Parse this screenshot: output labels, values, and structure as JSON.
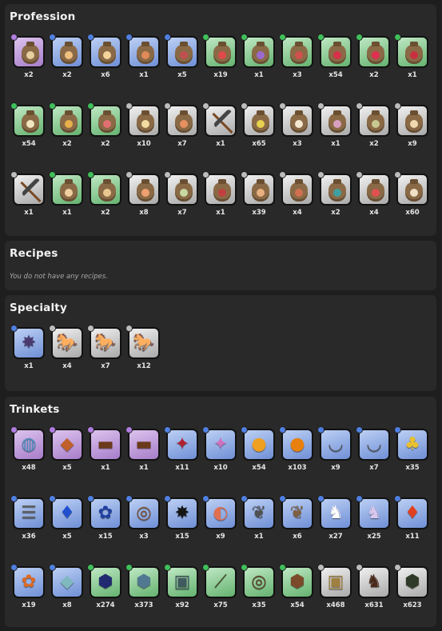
{
  "sections": {
    "profession": {
      "title": "Profession",
      "rows": [
        [
          {
            "icon": "seed-bag-icon",
            "rarity": "purple",
            "seed": "#e8cfa0",
            "qty": "x2"
          },
          {
            "icon": "seed-bag-icon",
            "rarity": "blue",
            "seed": "#f0c080",
            "qty": "x2"
          },
          {
            "icon": "seed-bag-icon",
            "rarity": "blue",
            "seed": "#f6d39a",
            "qty": "x6"
          },
          {
            "icon": "seed-bag-icon",
            "rarity": "blue",
            "seed": "#e08a5a",
            "qty": "x1"
          },
          {
            "icon": "seed-bag-icon",
            "rarity": "blue",
            "seed": "#c05050",
            "qty": "x5"
          },
          {
            "icon": "seed-bag-icon",
            "rarity": "green",
            "seed": "#e04a4a",
            "qty": "x19"
          },
          {
            "icon": "seed-bag-icon",
            "rarity": "green",
            "seed": "#9a6ad0",
            "qty": "x1"
          },
          {
            "icon": "seed-bag-icon",
            "rarity": "green",
            "seed": "#d05050",
            "qty": "x3"
          },
          {
            "icon": "seed-bag-icon",
            "rarity": "green",
            "seed": "#d8304a",
            "qty": "x54"
          },
          {
            "icon": "seed-bag-icon",
            "rarity": "green",
            "seed": "#e03050",
            "qty": "x2"
          },
          {
            "icon": "seed-bag-icon",
            "rarity": "green",
            "seed": "#c83040",
            "qty": "x1"
          }
        ],
        [
          {
            "icon": "seed-bag-icon",
            "rarity": "green",
            "seed": "#f0e6c0",
            "qty": "x54"
          },
          {
            "icon": "seed-bag-icon",
            "rarity": "green",
            "seed": "#e8b04a",
            "qty": "x2"
          },
          {
            "icon": "seed-bag-icon",
            "rarity": "green",
            "seed": "#e07070",
            "qty": "x2"
          },
          {
            "icon": "seed-bag-icon",
            "rarity": "grey",
            "seed": "#f2dca0",
            "qty": "x10"
          },
          {
            "icon": "seed-bag-icon",
            "rarity": "grey",
            "seed": "#e89060",
            "qty": "x7"
          },
          {
            "icon": "pickaxe-icon",
            "rarity": "grey",
            "qty": "x1"
          },
          {
            "icon": "seed-bag-icon",
            "rarity": "grey",
            "seed": "#e8d050",
            "qty": "x65"
          },
          {
            "icon": "seed-bag-icon",
            "rarity": "grey",
            "seed": "#f4e8d0",
            "qty": "x3"
          },
          {
            "icon": "seed-bag-icon",
            "rarity": "grey",
            "seed": "#d8a0c0",
            "qty": "x1"
          },
          {
            "icon": "seed-bag-icon",
            "rarity": "grey",
            "seed": "#c8c890",
            "qty": "x2"
          },
          {
            "icon": "seed-bag-icon",
            "rarity": "grey",
            "seed": "#f0d8b0",
            "qty": "x9"
          }
        ],
        [
          {
            "icon": "pickaxe-icon",
            "rarity": "grey",
            "qty": "x1"
          },
          {
            "icon": "seed-bag-icon",
            "rarity": "green",
            "seed": "#f0d0a0",
            "qty": "x1"
          },
          {
            "icon": "seed-bag-icon",
            "rarity": "green",
            "seed": "#e8c890",
            "qty": "x2"
          },
          {
            "icon": "seed-bag-icon",
            "rarity": "grey",
            "seed": "#f0a070",
            "qty": "x8"
          },
          {
            "icon": "seed-bag-icon",
            "rarity": "grey",
            "seed": "#c8d8a0",
            "qty": "x7"
          },
          {
            "icon": "seed-bag-icon",
            "rarity": "grey",
            "seed": "#c04040",
            "qty": "x1"
          },
          {
            "icon": "seed-bag-icon",
            "rarity": "grey",
            "seed": "#e8b080",
            "qty": "x39"
          },
          {
            "icon": "seed-bag-icon",
            "rarity": "grey",
            "seed": "#d07050",
            "qty": "x4"
          },
          {
            "icon": "seed-bag-icon",
            "rarity": "grey",
            "seed": "#40a0a0",
            "qty": "x2"
          },
          {
            "icon": "seed-bag-icon",
            "rarity": "grey",
            "seed": "#e05050",
            "qty": "x4"
          },
          {
            "icon": "seed-bag-icon",
            "rarity": "grey",
            "seed": "#f0e0c8",
            "qty": "x60"
          }
        ]
      ]
    },
    "recipes": {
      "title": "Recipes",
      "empty_note": "You do not have any recipes."
    },
    "specialty": {
      "title": "Specialty",
      "rows": [
        [
          {
            "icon": "dark-wings-icon",
            "rarity": "blue",
            "glyph": "✸",
            "color": "#4a3a70",
            "qty": "x1"
          },
          {
            "icon": "white-horse-scroll-icon",
            "rarity": "grey",
            "glyph": "🐎",
            "color": "#ffffff",
            "qty": "x4"
          },
          {
            "icon": "white-horse-scroll-icon",
            "rarity": "grey",
            "glyph": "🐎",
            "color": "#ffffff",
            "qty": "x7"
          },
          {
            "icon": "white-horse-scroll-icon",
            "rarity": "grey",
            "glyph": "🐎",
            "color": "#ffffff",
            "qty": "x12"
          }
        ]
      ]
    },
    "trinkets": {
      "title": "Trinkets",
      "rows": [
        [
          {
            "icon": "geode-icon",
            "rarity": "purple",
            "glyph": "◍",
            "color": "#4a90c0",
            "qty": "x48"
          },
          {
            "icon": "ore-chunk-icon",
            "rarity": "purple",
            "glyph": "◆",
            "color": "#c0602a",
            "qty": "x5"
          },
          {
            "icon": "treasure-chest-icon",
            "rarity": "purple",
            "glyph": "▬",
            "color": "#6a3a1a",
            "qty": "x1"
          },
          {
            "icon": "treasure-chest-icon",
            "rarity": "purple",
            "glyph": "▬",
            "color": "#6a3a1a",
            "qty": "x1"
          },
          {
            "icon": "dragon-plush-red-icon",
            "rarity": "blue",
            "glyph": "✦",
            "color": "#b02030",
            "qty": "x11"
          },
          {
            "icon": "dragon-plush-pink-icon",
            "rarity": "blue",
            "glyph": "✦",
            "color": "#d070c0",
            "qty": "x10"
          },
          {
            "icon": "amber-stone-icon",
            "rarity": "blue",
            "glyph": "●",
            "color": "#f0a020",
            "qty": "x54"
          },
          {
            "icon": "amber-stone-icon",
            "rarity": "blue",
            "glyph": "●",
            "color": "#e88010",
            "qty": "x103"
          },
          {
            "icon": "tooth-necklace-icon",
            "rarity": "blue",
            "glyph": "◡",
            "color": "#505050",
            "qty": "x9"
          },
          {
            "icon": "tooth-necklace-icon",
            "rarity": "blue",
            "glyph": "◡",
            "color": "#505050",
            "qty": "x7"
          },
          {
            "icon": "pineapple-icon",
            "rarity": "blue",
            "glyph": "♣",
            "color": "#e8c030",
            "qty": "x35"
          }
        ],
        [
          {
            "icon": "claw-bracelet-icon",
            "rarity": "blue",
            "glyph": "☰",
            "color": "#606060",
            "qty": "x36"
          },
          {
            "icon": "blue-gem-icon",
            "rarity": "blue",
            "glyph": "♦",
            "color": "#2050d0",
            "qty": "x5"
          },
          {
            "icon": "blue-rose-icon",
            "rarity": "blue",
            "glyph": "✿",
            "color": "#2040a0",
            "qty": "x15"
          },
          {
            "icon": "dreamcatcher-icon",
            "rarity": "blue",
            "glyph": "◎",
            "color": "#7a5030",
            "qty": "x3"
          },
          {
            "icon": "black-star-icon",
            "rarity": "blue",
            "glyph": "✸",
            "color": "#151515",
            "qty": "x15"
          },
          {
            "icon": "geode-slice-icon",
            "rarity": "blue",
            "glyph": "◐",
            "color": "#e07050",
            "qty": "x9"
          },
          {
            "icon": "bat-plush-icon",
            "rarity": "blue",
            "glyph": "❦",
            "color": "#505050",
            "qty": "x1"
          },
          {
            "icon": "bat-plush-brown-icon",
            "rarity": "blue",
            "glyph": "❦",
            "color": "#806040",
            "qty": "x6"
          },
          {
            "icon": "bunny-plush-white-icon",
            "rarity": "blue",
            "glyph": "♞",
            "color": "#ffffff",
            "qty": "x27"
          },
          {
            "icon": "bunny-plush-lavender-icon",
            "rarity": "blue",
            "glyph": "♞",
            "color": "#d8c8f0",
            "qty": "x25"
          },
          {
            "icon": "red-gem-icon",
            "rarity": "blue",
            "glyph": "♦",
            "color": "#e04020",
            "qty": "x11"
          }
        ],
        [
          {
            "icon": "orange-rose-icon",
            "rarity": "blue",
            "glyph": "✿",
            "color": "#e06a20",
            "qty": "x19"
          },
          {
            "icon": "crystal-rock-icon",
            "rarity": "blue",
            "glyph": "◆",
            "color": "#80b8c0",
            "qty": "x8"
          },
          {
            "icon": "blue-ore-icon",
            "rarity": "green",
            "glyph": "⬢",
            "color": "#202a70",
            "qty": "x274"
          },
          {
            "icon": "rock-cluster-icon",
            "rarity": "green",
            "glyph": "⬢",
            "color": "#507890",
            "qty": "x373"
          },
          {
            "icon": "glass-jar-icon",
            "rarity": "green",
            "glyph": "▣",
            "color": "#405a60",
            "qty": "x92"
          },
          {
            "icon": "twig-bundle-icon",
            "rarity": "green",
            "glyph": "⟋",
            "color": "#3a4020",
            "qty": "x75"
          },
          {
            "icon": "web-dreamcatcher-icon",
            "rarity": "green",
            "glyph": "◎",
            "color": "#5a3a20",
            "qty": "x35"
          },
          {
            "icon": "rock-pile-icon",
            "rarity": "green",
            "glyph": "⬢",
            "color": "#7a4a2a",
            "qty": "x54"
          },
          {
            "icon": "honey-jar-icon",
            "rarity": "grey",
            "glyph": "▣",
            "color": "#a08040",
            "qty": "x468"
          },
          {
            "icon": "horse-plush-icon",
            "rarity": "grey",
            "glyph": "♞",
            "color": "#4a2a1a",
            "qty": "x631"
          },
          {
            "icon": "moss-rock-icon",
            "rarity": "grey",
            "glyph": "⬢",
            "color": "#303a28",
            "qty": "x623"
          }
        ]
      ]
    }
  }
}
